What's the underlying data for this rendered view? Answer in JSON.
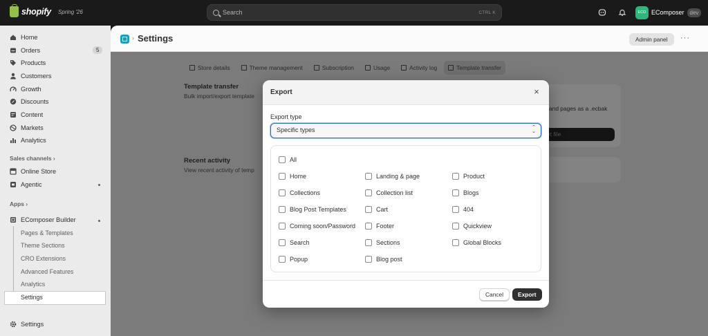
{
  "topbar": {
    "brand": "shopify",
    "edition": "Spring '26",
    "search_placeholder": "Search",
    "search_shortcut": "CTRL   K",
    "store_avatar": "ECO",
    "store_name": "EComposer",
    "store_badge": "dev"
  },
  "sidebar": {
    "items": [
      {
        "label": "Home",
        "icon": "home-icon"
      },
      {
        "label": "Orders",
        "icon": "orders-icon",
        "count": "5"
      },
      {
        "label": "Products",
        "icon": "tag-icon"
      },
      {
        "label": "Customers",
        "icon": "person-icon"
      },
      {
        "label": "Growth",
        "icon": "gauge-icon"
      },
      {
        "label": "Discounts",
        "icon": "discount-icon"
      },
      {
        "label": "Content",
        "icon": "content-icon"
      },
      {
        "label": "Markets",
        "icon": "globe-icon"
      },
      {
        "label": "Analytics",
        "icon": "bar-chart-icon"
      }
    ],
    "sales_channels_label": "Sales channels",
    "channels": [
      {
        "label": "Online Store",
        "icon": "store-icon"
      },
      {
        "label": "Agentic",
        "icon": "agentic-icon"
      }
    ],
    "apps_label": "Apps",
    "app_name": "EComposer Builder",
    "app_subitems": [
      "Pages & Templates",
      "Theme Sections",
      "CRO Extensions",
      "Advanced Features",
      "Analytics",
      "Settings"
    ],
    "settings_label": "Settings"
  },
  "header": {
    "title": "Settings",
    "admin_button": "Admin panel"
  },
  "tabs": [
    "Store details",
    "Theme management",
    "Subscription",
    "Usage",
    "Activity log",
    "Template transfer"
  ],
  "background": {
    "transfer_title": "Template transfer",
    "transfer_desc": "Bulk import/export template",
    "card_text": "and pages as a .ecbak",
    "card_button": "rt file",
    "recent_title": "Recent activity",
    "recent_desc": "View recent activity of temp"
  },
  "modal": {
    "title": "Export",
    "export_type_label": "Export type",
    "export_type_value": "Specific types",
    "all_label": "All",
    "options": [
      [
        "Home",
        "Landing & page",
        "Product"
      ],
      [
        "Collections",
        "Collection list",
        "Blogs"
      ],
      [
        "Blog Post Templates",
        "Cart",
        "404"
      ],
      [
        "Coming soon/Password",
        "Footer",
        "Quickview"
      ],
      [
        "Search",
        "Sections",
        "Global Blocks"
      ],
      [
        "Popup",
        "Blog post"
      ]
    ],
    "cancel_label": "Cancel",
    "export_label": "Export"
  }
}
